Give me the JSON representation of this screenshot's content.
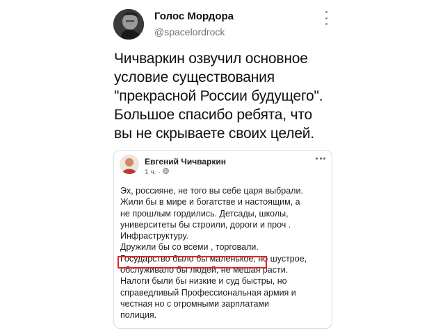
{
  "tweet": {
    "author_name": "Голос Мордора",
    "author_handle": "@spacelordrock",
    "text_lines": [
      "Чичваркин озвучил основное",
      "условие существования",
      "\"прекрасной России будущего\".",
      "Большое спасибо ребята, что",
      "вы не скрываете своих целей."
    ],
    "icons": {
      "avatar": "user-avatar",
      "menu": "more-vertical-icon"
    }
  },
  "quoted_post": {
    "author_name": "Евгений Чичваркин",
    "time": "1 ч.",
    "separator": "·",
    "icons": {
      "audience": "globe-icon",
      "menu": "more-horizontal-icon"
    },
    "text_lines": [
      "Эх, россияне, не того вы себе царя выбрали.",
      "Жили бы в мире и богатстве и настоящим, а",
      "не прошлым гордились. Детсады, школы,",
      "университеты бы строили, дороги и проч .",
      "Инфраструктуру.",
      "Дружили бы со всеми , торговали.",
      "Государство было бы маленькое, но шустрое,",
      "обслуживало бы людей, не мешая расти.",
      "Налоги были бы низкие и суд быстры, но",
      "справедливый   Профессиональная армия и",
      "честная но с огромными зарплатами",
      "полиция."
    ],
    "highlighted_phrase": "Государство было бы маленькое",
    "highlight_color": "#e0251f"
  }
}
